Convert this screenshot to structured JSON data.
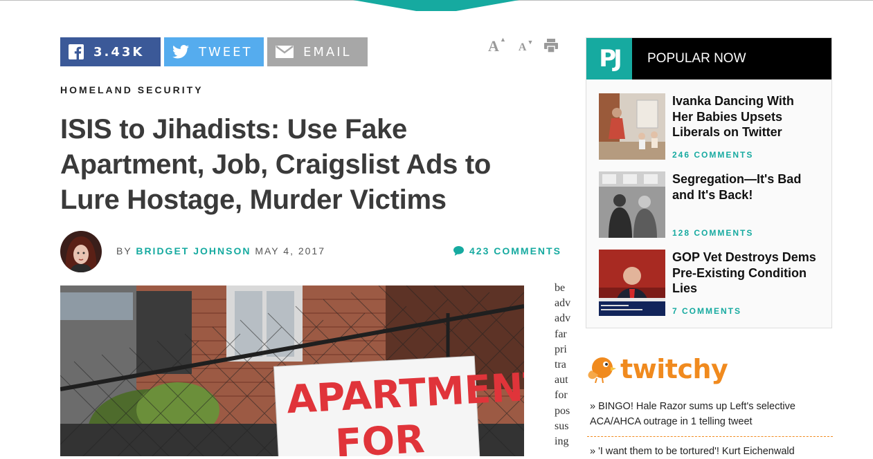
{
  "share": {
    "facebook_count": "3.43K",
    "tweet_label": "TWEET",
    "email_label": "EMAIL"
  },
  "tools": {
    "increase_font": "A",
    "decrease_font": "A"
  },
  "article": {
    "category": "HOMELAND SECURITY",
    "headline": "ISIS to Jihadists: Use Fake Apartment, Job, Craigslist Ads to Lure Hostage, Murder Victims",
    "by": "BY",
    "author": "BRIDGET JOHNSON",
    "date": "MAY 4, 2017",
    "comments": "423 COMMENTS",
    "photo_sign_line1": "APARTMENT",
    "photo_sign_line2": "FOR",
    "cutoff_text": [
      "be",
      "adv",
      "adv",
      "far",
      "pri",
      "tra",
      "aut",
      "for",
      "pos",
      "sus",
      "ing"
    ]
  },
  "popular": {
    "logo": "PJ",
    "title": "POPULAR NOW",
    "stories": [
      {
        "title": "Ivanka Dancing With Her Babies Upsets Liberals on Twitter",
        "comments": "246 COMMENTS"
      },
      {
        "title": "Segregation—It's Bad and It's Back!",
        "comments": "128 COMMENTS"
      },
      {
        "title": "GOP Vet Destroys Dems Pre-Existing Condition Lies",
        "comments": "7 COMMENTS"
      }
    ]
  },
  "twitchy": {
    "brand": "twitchy",
    "links": [
      "» BINGO! Hale Razor sums up Left's selective ACA/AHCA outrage in 1 telling tweet",
      "» 'I want them to be tortured'! Kurt Eichenwald"
    ]
  },
  "colors": {
    "accent": "#16aaa0",
    "facebook": "#3b5998",
    "twitter": "#55acee",
    "email": "#a7a7a7",
    "twitchy": "#f08a1e"
  }
}
